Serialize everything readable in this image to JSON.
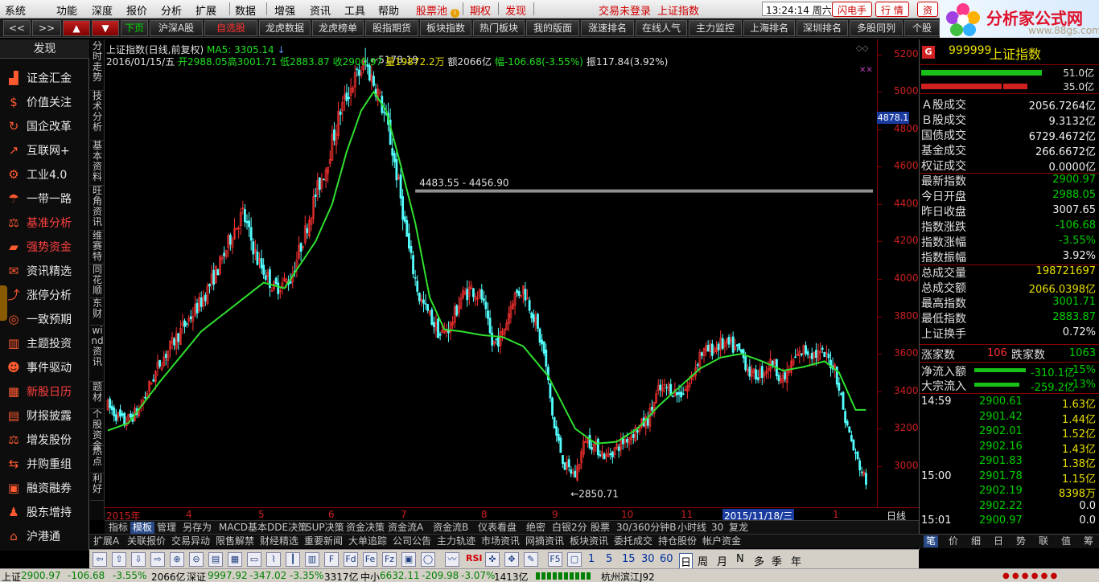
{
  "menubar": {
    "items": [
      "系统",
      "功能",
      "深度",
      "报价",
      "分析",
      "扩展",
      "数据",
      "增强",
      "资讯",
      "工具",
      "帮助"
    ],
    "stock_pool": "股票池",
    "rights": "期权",
    "discover": "发现",
    "login_status": "交易未登录",
    "index_name": "上证指数",
    "clock": "13:24:14 周六",
    "flash_btn": "闪电手",
    "market_btn": "行 情",
    "zi_btn": "资"
  },
  "logo": {
    "title": "分析家公式网",
    "url_text": "www.88gs.com"
  },
  "toolbar": {
    "items": [
      "<<",
      ">>",
      "▲",
      "▼",
      "下页",
      "沪深A股",
      "自选股",
      "龙虎数据",
      "龙虎榜单",
      "股指期货",
      "板块指数",
      "热门板块",
      "我的版面",
      "涨速排名",
      "在线人气",
      "主力监控",
      "上海排名",
      "深圳排名",
      "多股同列",
      "个股"
    ]
  },
  "sidebar": {
    "header": "发现",
    "items": [
      {
        "label": "证金汇金",
        "icon": "chart-bar-icon"
      },
      {
        "label": "价值关注",
        "icon": "coin-icon"
      },
      {
        "label": "国企改革",
        "icon": "refresh-icon"
      },
      {
        "label": "互联网+",
        "icon": "line-chart-icon"
      },
      {
        "label": "工业4.0",
        "icon": "gear-icon"
      },
      {
        "label": "一带一路",
        "icon": "umbrella-icon"
      },
      {
        "label": "基准分析",
        "icon": "scale-icon",
        "red": true
      },
      {
        "label": "强势资金",
        "icon": "briefcase-icon",
        "red": true
      },
      {
        "label": "资讯精选",
        "icon": "chat-icon"
      },
      {
        "label": "涨停分析",
        "icon": "analysis-icon"
      },
      {
        "label": "一致预期",
        "icon": "target-icon"
      },
      {
        "label": "主题投资",
        "icon": "building-icon"
      },
      {
        "label": "事件驱动",
        "icon": "person-icon"
      },
      {
        "label": "新股日历",
        "icon": "calendar-icon",
        "red": true
      },
      {
        "label": "财报披露",
        "icon": "report-icon"
      },
      {
        "label": "增发股份",
        "icon": "scale2-icon"
      },
      {
        "label": "并购重组",
        "icon": "merge-icon"
      },
      {
        "label": "融资融券",
        "icon": "wallet-icon"
      },
      {
        "label": "股东增持",
        "icon": "shareholder-icon"
      },
      {
        "label": "沪港通",
        "icon": "bridge-icon"
      }
    ]
  },
  "vtabs": [
    "分时走势",
    "技术分析",
    "基本资料",
    "旺角资讯",
    "维赛特",
    "同花顺",
    "东财",
    "wind资讯",
    "题材",
    "个股资金",
    "热点",
    "利好"
  ],
  "chart_header": {
    "title": "上证指数(日线,前复权)",
    "ma_label": "MA5: 3305.14",
    "date": "2016/01/15/五",
    "open": "开2988.05",
    "high": "高3001.71",
    "low": "低2883.87",
    "close": "收2900.97",
    "volume": "量19872.2万",
    "amount": "额2066亿",
    "change": "幅-106.68(-3.55%)",
    "amplitude": "振117.84(3.92%)"
  },
  "chart_data": {
    "type": "candlestick",
    "yaxis_ticks": [
      5200,
      5000,
      4800,
      4600,
      4400,
      4200,
      4000,
      3800,
      3600,
      3400,
      3200,
      3000
    ],
    "ylim": [
      2780,
      5280
    ],
    "x_labels": [
      "2015年",
      "4",
      "5",
      "6",
      "7",
      "8",
      "9",
      "10",
      "11",
      "2015/11/18/三",
      "1",
      "日线"
    ],
    "annotations": {
      "high": "5178.19",
      "low": "2850.71",
      "range": "4483.55 - 4456.90"
    },
    "current_price": "4878.1",
    "ma_key_points": [
      [
        0,
        3190
      ],
      [
        10,
        3230
      ],
      [
        25,
        3450
      ],
      [
        45,
        3720
      ],
      [
        60,
        3850
      ],
      [
        75,
        3980
      ],
      [
        85,
        3950
      ],
      [
        100,
        4200
      ],
      [
        108,
        4400
      ],
      [
        115,
        4680
      ],
      [
        122,
        4900
      ],
      [
        128,
        5000
      ],
      [
        134,
        4900
      ],
      [
        140,
        4650
      ],
      [
        148,
        4300
      ],
      [
        155,
        3900
      ],
      [
        162,
        3730
      ],
      [
        170,
        3720
      ],
      [
        180,
        3700
      ],
      [
        190,
        3690
      ],
      [
        200,
        3640
      ],
      [
        212,
        3480
      ],
      [
        225,
        3200
      ],
      [
        235,
        3120
      ],
      [
        245,
        3130
      ],
      [
        255,
        3200
      ],
      [
        265,
        3320
      ],
      [
        275,
        3420
      ],
      [
        285,
        3520
      ],
      [
        295,
        3580
      ],
      [
        305,
        3600
      ],
      [
        315,
        3560
      ],
      [
        325,
        3510
      ],
      [
        335,
        3530
      ],
      [
        345,
        3560
      ],
      [
        352,
        3500
      ],
      [
        360,
        3300
      ]
    ],
    "price_key_points": [
      [
        0,
        3320
      ],
      [
        8,
        3230
      ],
      [
        15,
        3300
      ],
      [
        25,
        3550
      ],
      [
        35,
        3720
      ],
      [
        45,
        3880
      ],
      [
        55,
        4100
      ],
      [
        60,
        4250
      ],
      [
        65,
        4350
      ],
      [
        72,
        4100
      ],
      [
        80,
        3950
      ],
      [
        88,
        4000
      ],
      [
        95,
        4250
      ],
      [
        100,
        4450
      ],
      [
        105,
        4600
      ],
      [
        112,
        4900
      ],
      [
        118,
        5050
      ],
      [
        124,
        5150
      ],
      [
        130,
        5000
      ],
      [
        135,
        4800
      ],
      [
        140,
        4500
      ],
      [
        145,
        4150
      ],
      [
        150,
        3900
      ],
      [
        155,
        3800
      ],
      [
        160,
        3700
      ],
      [
        165,
        3750
      ],
      [
        170,
        3900
      ],
      [
        175,
        3950
      ],
      [
        180,
        3900
      ],
      [
        185,
        3650
      ],
      [
        190,
        3700
      ],
      [
        195,
        3900
      ],
      [
        200,
        3950
      ],
      [
        205,
        3800
      ],
      [
        210,
        3600
      ],
      [
        215,
        3200
      ],
      [
        220,
        3000
      ],
      [
        225,
        2950
      ],
      [
        230,
        3150
      ],
      [
        235,
        3100
      ],
      [
        240,
        3050
      ],
      [
        245,
        3100
      ],
      [
        250,
        3150
      ],
      [
        255,
        3200
      ],
      [
        260,
        3250
      ],
      [
        265,
        3400
      ],
      [
        270,
        3420
      ],
      [
        275,
        3380
      ],
      [
        280,
        3440
      ],
      [
        285,
        3600
      ],
      [
        290,
        3620
      ],
      [
        295,
        3650
      ],
      [
        300,
        3640
      ],
      [
        305,
        3600
      ],
      [
        310,
        3480
      ],
      [
        315,
        3500
      ],
      [
        320,
        3560
      ],
      [
        325,
        3450
      ],
      [
        330,
        3560
      ],
      [
        335,
        3620
      ],
      [
        340,
        3600
      ],
      [
        345,
        3590
      ],
      [
        350,
        3530
      ],
      [
        355,
        3250
      ],
      [
        360,
        3050
      ],
      [
        365,
        2920
      ]
    ]
  },
  "right_panel": {
    "code_badge": "G",
    "code": "999999",
    "name": "上证指数",
    "bar1_value": "51.0亿",
    "bar2_value": "35.0亿",
    "stats": [
      {
        "label": "Ａ股成交",
        "value": "2056.7264亿",
        "color": "white"
      },
      {
        "label": "Ｂ股成交",
        "value": "9.3132亿",
        "color": "white"
      },
      {
        "label": "国债成交",
        "value": "6729.4672亿",
        "color": "white"
      },
      {
        "label": "基金成交",
        "value": "266.6672亿",
        "color": "white"
      },
      {
        "label": "权证成交",
        "value": "0.0000亿",
        "color": "white"
      },
      {
        "label": "最新指数",
        "value": "2900.97",
        "color": "green"
      },
      {
        "label": "今日开盘",
        "value": "2988.05",
        "color": "green"
      },
      {
        "label": "昨日收盘",
        "value": "3007.65",
        "color": "white"
      },
      {
        "label": "指数涨跌",
        "value": "-106.68",
        "color": "green"
      },
      {
        "label": "指数涨幅",
        "value": "-3.55%",
        "color": "green"
      },
      {
        "label": "指数振幅",
        "value": "3.92%",
        "color": "white"
      },
      {
        "label": "总成交量",
        "value": "198721697",
        "color": "yellow"
      },
      {
        "label": "总成交额",
        "value": "2066.0398亿",
        "color": "yellow"
      },
      {
        "label": "最高指数",
        "value": "3001.71",
        "color": "green"
      },
      {
        "label": "最低指数",
        "value": "2883.87",
        "color": "green"
      },
      {
        "label": "上证换手",
        "value": "0.72%",
        "color": "white"
      }
    ],
    "up_label": "涨家数",
    "up_count": "106",
    "down_label": "跌家数",
    "down_count": "1063",
    "netflow_label": "净流入额",
    "netflow_value": "-310.1亿",
    "netflow_pct": "-15%",
    "block_label": "大宗流入",
    "block_value": "-259.2亿",
    "block_pct": "-13%",
    "ticks": [
      {
        "time": "14:59",
        "price": "2900.61",
        "vol": "1.63亿"
      },
      {
        "time": "",
        "price": "2901.42",
        "vol": "1.44亿"
      },
      {
        "time": "",
        "price": "2902.01",
        "vol": "1.52亿"
      },
      {
        "time": "",
        "price": "2902.16",
        "vol": "1.43亿"
      },
      {
        "time": "",
        "price": "2901.83",
        "vol": "1.38亿"
      },
      {
        "time": "15:00",
        "price": "2901.78",
        "vol": "1.15亿"
      },
      {
        "time": "",
        "price": "2902.19",
        "vol": "8398万"
      },
      {
        "time": "",
        "price": "2902.22",
        "vol": "0.0"
      },
      {
        "time": "15:01",
        "price": "2900.97",
        "vol": "0.0"
      }
    ],
    "tabs": [
      "笔",
      "价",
      "细",
      "日",
      "势",
      "联",
      "值",
      "筹"
    ]
  },
  "bottom_tabs1": [
    "指标",
    "模板",
    "管理",
    "另存为",
    "MACD基本",
    "DDE决策",
    "SUP决策",
    "资金决策",
    "资金流A",
    "资金流B",
    "仪表看盘",
    "绝密",
    "白银2分",
    "股票",
    "30/360分钟B",
    "小时线",
    "30",
    "复龙"
  ],
  "bottom_tabs2": [
    "扩展A",
    "关联报价",
    "交易异动",
    "限售解禁",
    "财经精选",
    "重要新闻",
    "大单追踪",
    "公司公告",
    "主力轨迹",
    "市场资讯",
    "网摘资讯",
    "板块资讯",
    "委托成交",
    "持仓股份",
    "帐户资金"
  ],
  "iconbar": {
    "periods": [
      "1",
      "5",
      "15",
      "30",
      "60"
    ],
    "period_units": [
      "日",
      "周",
      "月",
      "N",
      "多",
      "季",
      "年"
    ],
    "rsi": "RSI"
  },
  "statusbar": {
    "sh_label": "上证",
    "sh_value": "2900.97",
    "sh_change": "-106.68",
    "sh_pct": "-3.55%",
    "sh_amount": "2066亿",
    "sz_label": "深证",
    "sz_value": "9997.92",
    "sz_change": "-347.02",
    "sz_pct": "-3.35%",
    "sz_amount": "3317亿",
    "zx_label": "中小",
    "zx_value": "6632.11",
    "zx_change": "-209.98",
    "zx_pct": "-3.07%",
    "zx_amount": "1413亿",
    "server": "杭州滨江J92"
  }
}
